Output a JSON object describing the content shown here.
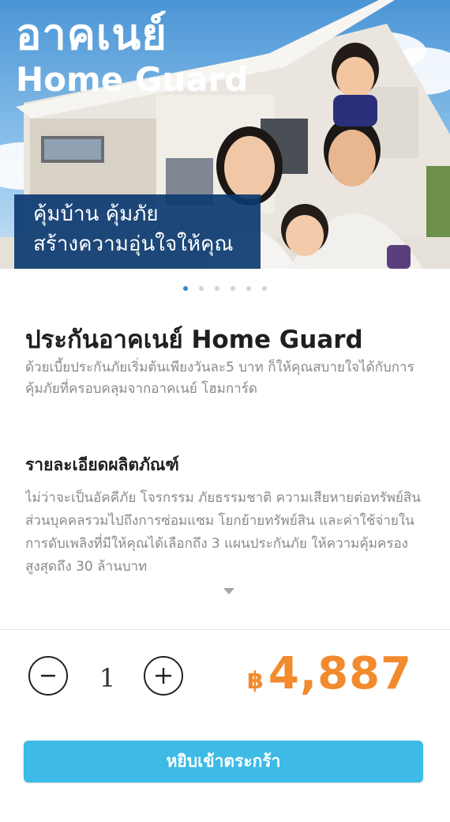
{
  "banner": {
    "title_th": "อาคเนย์",
    "title_en": "Home Guard",
    "slogan_line1": "คุ้มบ้าน คุ้มภัย",
    "slogan_line2": "สร้างความอุ่นใจให้คุณ"
  },
  "carousel": {
    "slide_count": 6,
    "active_index": 0
  },
  "product": {
    "title": "ประกันอาคเนย์ Home Guard",
    "description": "ด้วยเบี้ยประกันภัยเริ่มต้นเพียงวันละ5 บาท ก็ให้คุณสบายใจได้กับการคุ้มภัยที่ครอบคลุมจากอาคเนย์ โฮมการ์ด",
    "details_title": "รายละเอียดผลิตภัณฑ์",
    "details_text": "ไม่ว่าจะเป็นอัคคีภัย โจรกรรม ภัยธรรมชาติ ความเสียหายต่อทรัพย์สินส่วนบุคคลรวมไปถึงการซ่อมแซม โยกย้ายทรัพย์สิน และค่าใช้จ่ายในการดับเพลิงที่มีให้คุณได้เลือกถึง 3 แผนประกันภัย ให้ความคุ้มครองสูงสุดถึง 30 ล้านบาท"
  },
  "quantity": {
    "value": "1"
  },
  "price": {
    "currency": "฿",
    "amount": "4,887"
  },
  "cart": {
    "button_label": "หยิบเข้าตระกร้า"
  },
  "colors": {
    "accent_orange": "#f28a2e",
    "button_blue": "#3dbae6",
    "slogan_bg": "#0c3a70",
    "dot_active": "#3d82d4"
  },
  "icons": {
    "minus": "minus-icon",
    "plus": "plus-icon",
    "expand": "chevron-down-icon"
  }
}
